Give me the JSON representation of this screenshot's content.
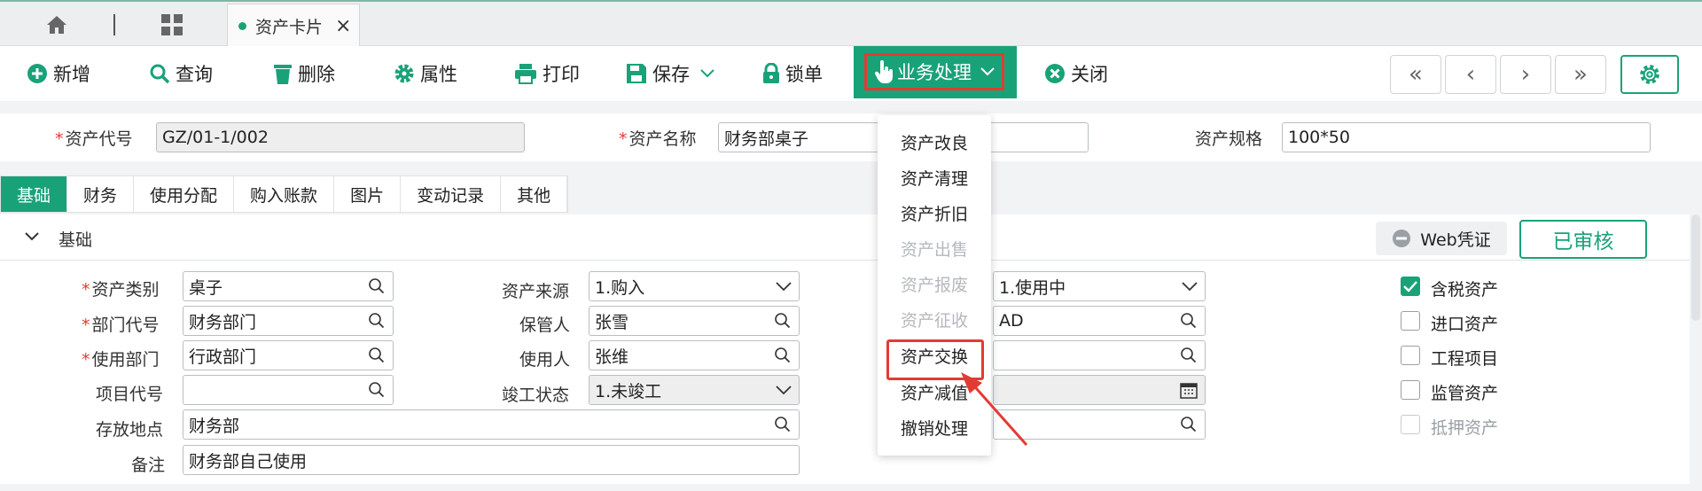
{
  "tabbar": {
    "doc_tab_label": "资产卡片",
    "close_glyph": "×"
  },
  "toolbar": {
    "add": "新增",
    "query": "查询",
    "delete": "删除",
    "properties": "属性",
    "print": "打印",
    "save": "保存",
    "lock": "锁单",
    "business": "业务处理",
    "close": "关闭",
    "nav": [
      "«",
      "‹",
      "›",
      "»"
    ]
  },
  "header": {
    "asset_code_label": "资产代号",
    "asset_code_value": "GZ/01-1/002",
    "asset_name_label": "资产名称",
    "asset_name_value": "财务部桌子",
    "asset_spec_label": "资产规格",
    "asset_spec_value": "100*50"
  },
  "subtabs": [
    "基础",
    "财务",
    "使用分配",
    "购入账款",
    "图片",
    "变动记录",
    "其他"
  ],
  "section": {
    "title": "基础",
    "web_voucher": "Web凭证",
    "status": "已审核"
  },
  "form": {
    "category_label": "资产类别",
    "category_value": "桌子",
    "dept_code_label": "部门代号",
    "dept_code_value": "财务部门",
    "use_dept_label": "使用部门",
    "use_dept_value": "行政部门",
    "project_label": "项目代号",
    "project_value": "",
    "location_label": "存放地点",
    "location_value": "财务部",
    "remark_label": "备注",
    "remark_value": "财务部自己使用",
    "source_label": "资产来源",
    "source_value": "1.购入",
    "keeper_label": "保管人",
    "keeper_value": "张雪",
    "user_label": "使用人",
    "user_value": "张维",
    "completion_label": "竣工状态",
    "completion_value": "1.未竣工",
    "status_value": "1.使用中",
    "col3_row2_value": "AD"
  },
  "checks": [
    {
      "label": "含税资产",
      "checked": true,
      "disabled": false
    },
    {
      "label": "进口资产",
      "checked": false,
      "disabled": false
    },
    {
      "label": "工程项目",
      "checked": false,
      "disabled": false
    },
    {
      "label": "监管资产",
      "checked": false,
      "disabled": false
    },
    {
      "label": "抵押资产",
      "checked": false,
      "disabled": true
    }
  ],
  "dropdown": [
    {
      "label": "资产改良",
      "disabled": false
    },
    {
      "label": "资产清理",
      "disabled": false
    },
    {
      "label": "资产折旧",
      "disabled": false
    },
    {
      "label": "资产出售",
      "disabled": true
    },
    {
      "label": "资产报废",
      "disabled": true
    },
    {
      "label": "资产征收",
      "disabled": true
    },
    {
      "label": "资产交换",
      "disabled": false
    },
    {
      "label": "资产减值",
      "disabled": false
    },
    {
      "label": "撤销处理",
      "disabled": false
    }
  ],
  "colors": {
    "accent": "#19a278",
    "highlight": "#e23b33"
  }
}
